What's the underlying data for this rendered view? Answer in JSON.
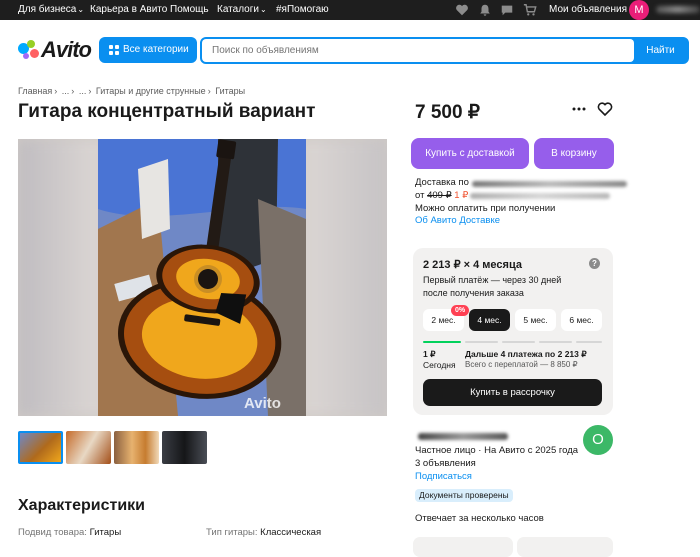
{
  "topnav": {
    "business": "Для бизнеса",
    "career": "Карьера в Авито",
    "help": "Помощь",
    "catalogs": "Каталоги",
    "ihelp": "#яПомогаю",
    "my_ads": "Мои объявления",
    "avatar_letter": "М"
  },
  "header": {
    "logo_text": "Avito",
    "categories_button": "Все категории",
    "search_placeholder": "Поиск по объявлениям",
    "find_button": "Найти"
  },
  "breadcrumb": [
    "Главная",
    "...",
    "...",
    "Гитары и другие струнные",
    "Гитары"
  ],
  "listing": {
    "title": "Гитара концентратный вариант",
    "price": "7 500 ₽",
    "photo_watermark": "Avito"
  },
  "purchase": {
    "buy_delivery": "Купить с доставкой",
    "add_to_cart": "В корзину",
    "delivery_label": "Доставка по",
    "delivery_from": "от",
    "delivery_old_price": "409 ₽",
    "delivery_new_price": "1 ₽",
    "pay_on_receipt": "Можно оплатить при получении",
    "about_delivery": "Об Авито Доставке"
  },
  "installment": {
    "title": "2 213 ₽ × 4 месяца",
    "subtitle": "Первый платёж — через 30 дней после получения заказа",
    "help": "?",
    "badge": "0%",
    "terms": [
      "2 мес.",
      "4 мес.",
      "5 мес.",
      "6 мес."
    ],
    "selected_term": "4 мес.",
    "first_amount": "1 ₽",
    "first_when": "Сегодня",
    "rest_label": "Дальше 4 платежа по 2 213 ₽",
    "overpay_label": "Всего с переплатой — 8 850 ₽",
    "buy_button": "Купить в рассрочку"
  },
  "seller": {
    "info": "Частное лицо · На Авито с 2025 года",
    "ads_count": "3 объявления",
    "subscribe": "Подписаться",
    "verified": "Документы проверены",
    "response": "Отвечает за несколько часов",
    "avatar_letter": "О"
  },
  "characteristics": {
    "heading": "Характеристики",
    "items": [
      {
        "key": "Подвид товара:",
        "value": "Гитары"
      },
      {
        "key": "Тип гитары:",
        "value": "Классическая"
      }
    ]
  },
  "colors": {
    "accent_blue": "#0a8ff0",
    "purple": "#965eeb",
    "green": "#02d15c",
    "dark": "#1a1a1a"
  }
}
